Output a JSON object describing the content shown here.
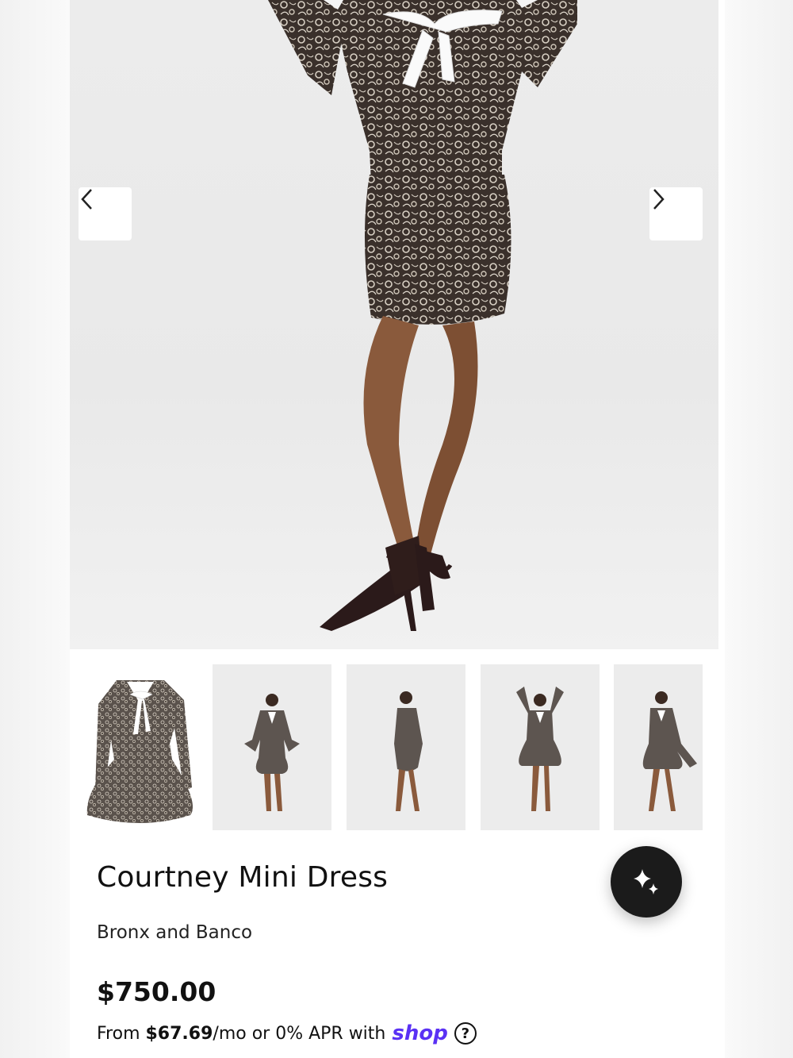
{
  "gallery": {
    "prev_label": "Previous image",
    "next_label": "Next image",
    "thumbnails": [
      {
        "name": "thumb-flat-lay"
      },
      {
        "name": "thumb-front-pose"
      },
      {
        "name": "thumb-side-pose"
      },
      {
        "name": "thumb-arms-up-pose"
      },
      {
        "name": "thumb-skirt-hold-pose"
      }
    ]
  },
  "product": {
    "title": "Courtney Mini Dress",
    "vendor": "Bronx and Banco",
    "price": "$750.00",
    "installments": {
      "prefix": "From ",
      "amount": "$67.69",
      "suffix": "/mo or 0% APR with",
      "provider": "shop",
      "help": "?"
    }
  },
  "fab": {
    "icon": "sparkles-icon"
  },
  "colors": {
    "accent": "#5a31f4",
    "fab": "#1b1b1b"
  }
}
